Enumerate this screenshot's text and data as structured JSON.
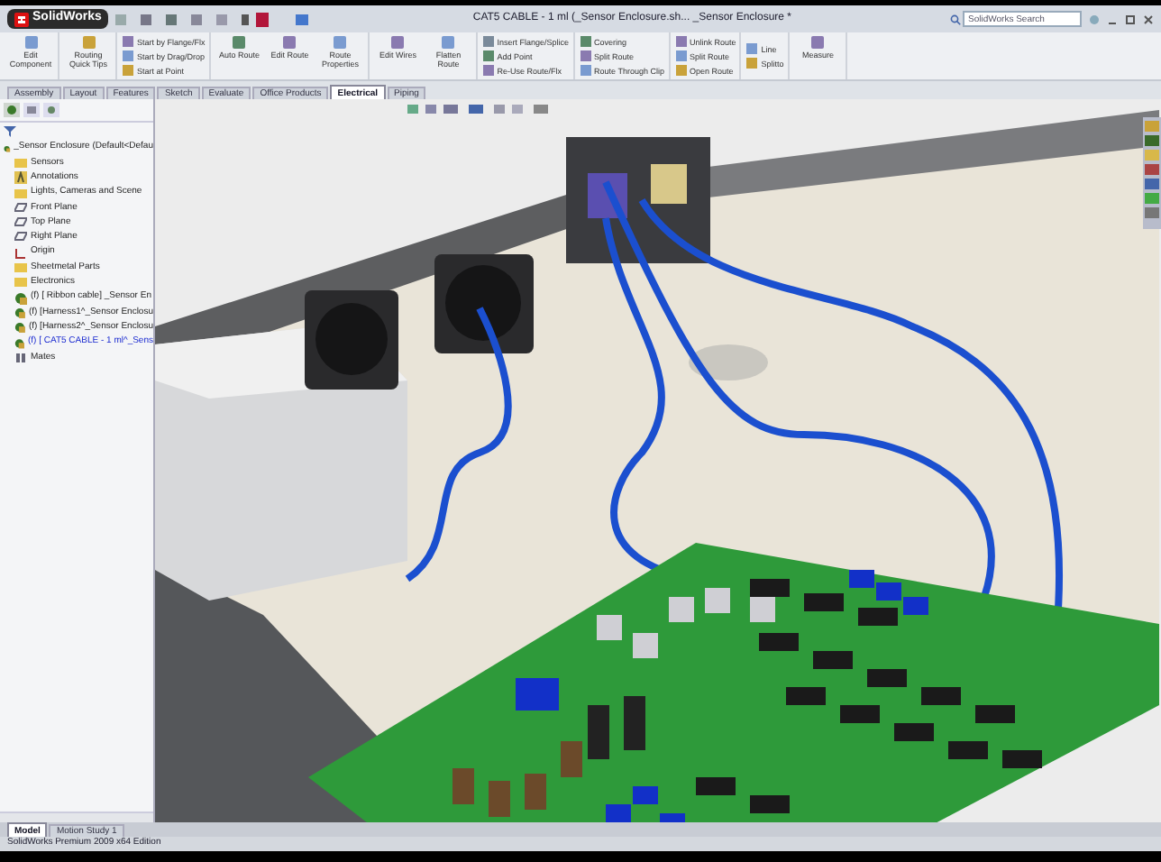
{
  "window": {
    "app": "SolidWorks",
    "title": "CAT5 CABLE - 1 ml (_Sensor Enclosure.sh... _Sensor Enclosure *",
    "search": {
      "placeholder": "SolidWorks Search"
    }
  },
  "ribbon": {
    "groups": [
      {
        "kind": "large",
        "buttons": [
          "Edit Component"
        ]
      },
      {
        "kind": "large",
        "buttons": [
          "Routing Quick Tips"
        ]
      },
      {
        "kind": "small",
        "buttons": [
          "Start by Flange/Flx",
          "Start by Drag/Drop",
          "Start at Point"
        ]
      },
      {
        "kind": "large",
        "buttons": [
          "Auto Route",
          "Edit Route",
          "Route Properties"
        ]
      },
      {
        "kind": "large",
        "buttons": [
          "Edit Wires",
          "Flatten Route"
        ]
      },
      {
        "kind": "small",
        "buttons": [
          "Insert Flange/Splice",
          "Add Point",
          "Re-Use Route/Flx"
        ]
      },
      {
        "kind": "small",
        "buttons": [
          "Covering",
          "Split Route",
          "Route Through Clip"
        ]
      },
      {
        "kind": "small",
        "buttons": [
          "Unlink Route",
          "Split Route",
          "Open Route"
        ]
      },
      {
        "kind": "small",
        "buttons": [
          "Line",
          "Splitto"
        ]
      },
      {
        "kind": "large",
        "buttons": [
          "Measure"
        ]
      }
    ]
  },
  "tabs": [
    {
      "label": "Assembly",
      "selected": false
    },
    {
      "label": "Layout",
      "selected": false
    },
    {
      "label": "Features",
      "selected": false
    },
    {
      "label": "Sketch",
      "selected": false
    },
    {
      "label": "Evaluate",
      "selected": false
    },
    {
      "label": "Office Products",
      "selected": false
    },
    {
      "label": "Electrical",
      "selected": true
    },
    {
      "label": "Piping",
      "selected": false
    }
  ],
  "tree": {
    "root": {
      "label": "_Sensor Enclosure  (Default<Defau",
      "kind": "assembly",
      "selected": false,
      "children": [
        {
          "label": "Sensors",
          "kind": "folder",
          "selected": false
        },
        {
          "label": "Annotations",
          "kind": "annotation",
          "selected": false
        },
        {
          "label": "Lights, Cameras and Scene",
          "kind": "folder",
          "selected": false
        },
        {
          "label": "Front Plane",
          "kind": "plane",
          "selected": false
        },
        {
          "label": "Top Plane",
          "kind": "plane",
          "selected": false
        },
        {
          "label": "Right Plane",
          "kind": "plane",
          "selected": false
        },
        {
          "label": "Origin",
          "kind": "origin",
          "selected": false
        },
        {
          "label": "Sheetmetal Parts",
          "kind": "folder",
          "selected": false
        },
        {
          "label": "Electronics",
          "kind": "folder",
          "selected": false
        },
        {
          "label": "(f) [ Ribbon cable] _Sensor En",
          "kind": "assembly",
          "selected": false
        },
        {
          "label": "(f) [Harness1^_Sensor Enclosu",
          "kind": "assembly",
          "selected": false
        },
        {
          "label": "(f) [Harness2^_Sensor Enclosu",
          "kind": "assembly",
          "selected": false
        },
        {
          "label": "(f) [ CAT5 CABLE - 1 ml^_Sens",
          "kind": "assembly",
          "selected": true
        },
        {
          "label": "Mates",
          "kind": "mates",
          "selected": false
        }
      ]
    }
  },
  "bottom_tabs": [
    {
      "label": "Model",
      "selected": true
    },
    {
      "label": "Motion Study 1",
      "selected": false
    }
  ],
  "status_bar": "SolidWorks Premium 2009 x64 Edition"
}
